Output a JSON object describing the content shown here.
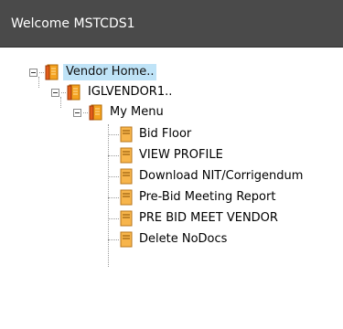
{
  "panel": {
    "title": "Welcome MSTCDS1"
  },
  "tree": {
    "root": {
      "label": "Vendor Home..",
      "icon": "book-icon",
      "expanded": true,
      "selected": true
    },
    "vendor": {
      "label": "IGLVENDOR1..",
      "icon": "book-icon",
      "expanded": true
    },
    "menu": {
      "label": "My Menu",
      "icon": "book-icon",
      "expanded": true
    },
    "items": [
      {
        "label": "Bid Floor",
        "icon": "page-icon"
      },
      {
        "label": "VIEW PROFILE",
        "icon": "page-icon"
      },
      {
        "label": "Download NIT/Corrigendum",
        "icon": "page-icon"
      },
      {
        "label": "Pre-Bid Meeting Report",
        "icon": "page-icon"
      },
      {
        "label": "PRE BID MEET VENDOR",
        "icon": "page-icon"
      },
      {
        "label": "Delete NoDocs",
        "icon": "page-icon"
      }
    ]
  },
  "colors": {
    "header_bg": "#4a4a4a",
    "header_text": "#ffffff",
    "selected_bg": "#bfe3f7",
    "book_icon": "#f0a020",
    "page_icon": "#f4b24a"
  }
}
